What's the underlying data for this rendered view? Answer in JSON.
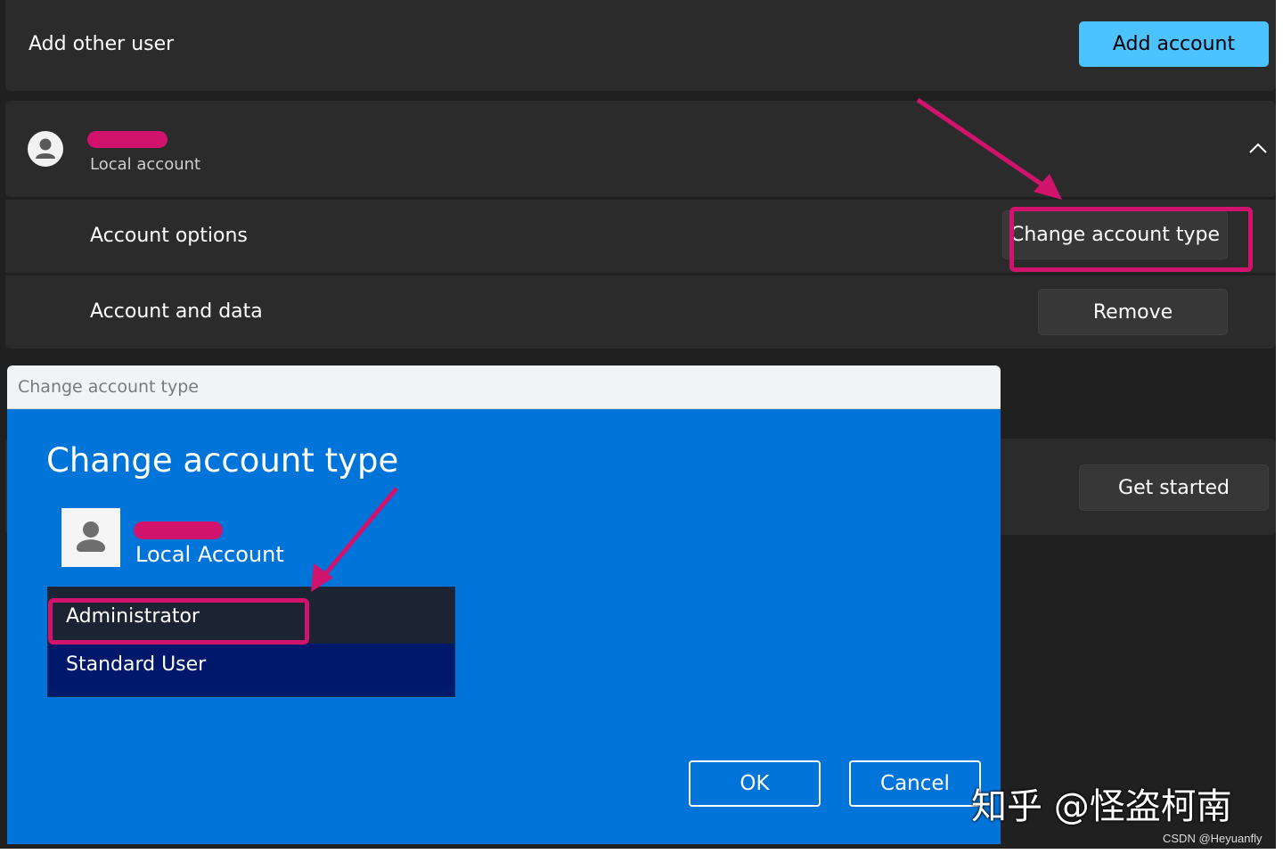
{
  "add_user": {
    "label": "Add other user",
    "button": "Add account"
  },
  "account": {
    "type": "Local account",
    "options_label": "Account options",
    "change_type_button": "Change account type",
    "data_label": "Account and data",
    "remove_button": "Remove"
  },
  "get_started_button": "Get started",
  "dialog": {
    "window_title": "Change account type",
    "heading": "Change account type",
    "account_type": "Local Account",
    "options": [
      "Administrator",
      "Standard User"
    ],
    "ok_button": "OK",
    "cancel_button": "Cancel"
  },
  "watermark": {
    "zhihu": "知乎 @怪盗柯南",
    "csdn": "CSDN @Heyuanfly"
  },
  "colors": {
    "accent": "#4cc2ff",
    "dialog_blue": "#0074d9",
    "annotation": "#d1136d"
  }
}
